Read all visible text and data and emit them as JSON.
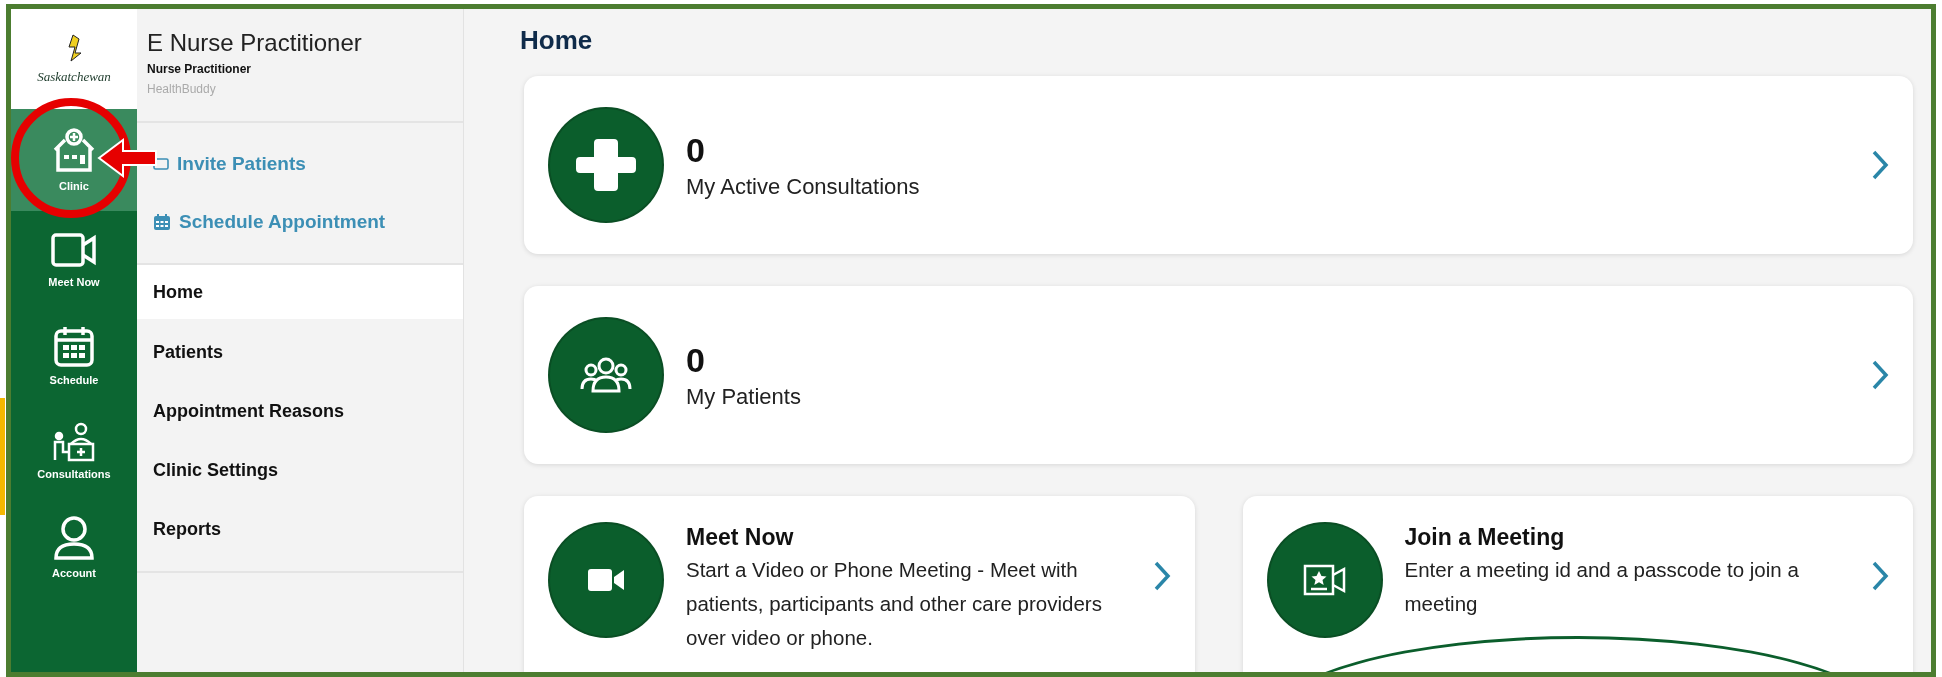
{
  "logo": {
    "text": "Saskatchewan"
  },
  "rail": [
    {
      "label": "Clinic",
      "kind": "clinic",
      "selected": true
    },
    {
      "label": "Meet Now",
      "kind": "video",
      "selected": false
    },
    {
      "label": "Schedule",
      "kind": "calendar",
      "selected": false
    },
    {
      "label": "Consultations",
      "kind": "desk",
      "selected": false
    },
    {
      "label": "Account",
      "kind": "person",
      "selected": false
    }
  ],
  "user": {
    "name": "E Nurse Practitioner",
    "role": "Nurse Practitioner",
    "org": "HealthBuddy"
  },
  "actions": [
    {
      "label": "Invite Patients",
      "kind": "envelope"
    },
    {
      "label": "Schedule Appointment",
      "kind": "calendar"
    }
  ],
  "nav": [
    {
      "label": "Home",
      "selected": true
    },
    {
      "label": "Patients",
      "selected": false
    },
    {
      "label": "Appointment Reasons",
      "selected": false
    },
    {
      "label": "Clinic Settings",
      "selected": false
    },
    {
      "label": "Reports",
      "selected": false
    }
  ],
  "page_title": "Home",
  "stat_cards": [
    {
      "count": "0",
      "label": "My Active Consultations",
      "kind": "plus"
    },
    {
      "count": "0",
      "label": "My Patients",
      "kind": "group"
    }
  ],
  "action_cards": [
    {
      "title": "Meet Now",
      "description": "Start a Video or Phone Meeting - Meet with patients, participants and other care providers over video or phone.",
      "kind": "video"
    },
    {
      "title": "Join a Meeting",
      "description": "Enter a meeting id and a passcode to join a meeting",
      "kind": "meeting"
    }
  ]
}
